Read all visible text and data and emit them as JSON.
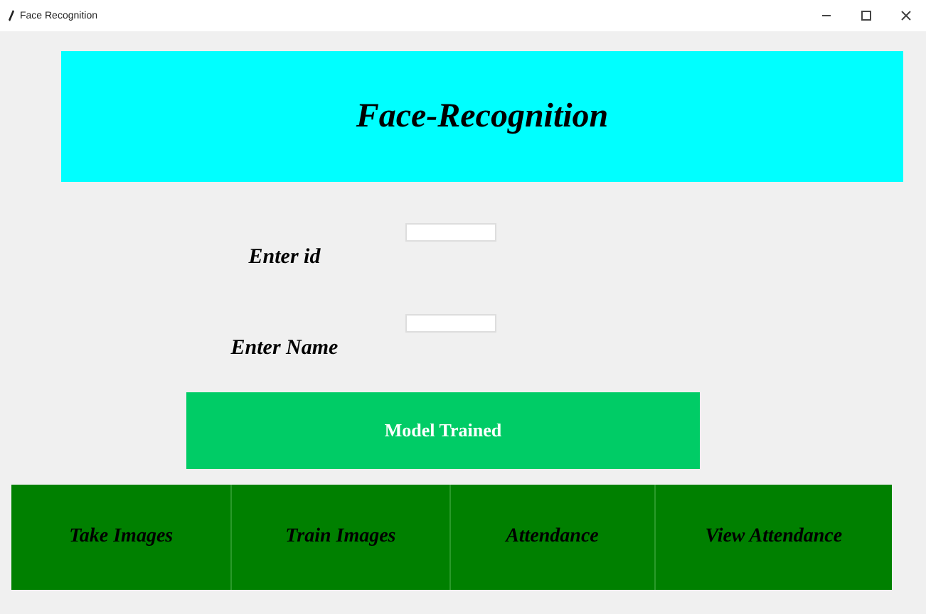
{
  "window": {
    "title": "Face Recognition"
  },
  "banner": {
    "title": "Face-Recognition"
  },
  "fields": [
    {
      "label": "Enter id"
    },
    {
      "label": "Enter Name"
    }
  ],
  "status_button": {
    "label": "Model Trained"
  },
  "buttons": [
    {
      "label": "Take Images"
    },
    {
      "label": "Train Images"
    },
    {
      "label": "Attendance"
    },
    {
      "label": "View Attendance"
    }
  ]
}
